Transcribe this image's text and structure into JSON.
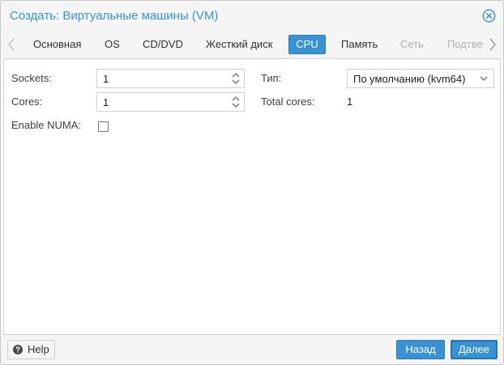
{
  "window": {
    "title": "Создать: Виртуальные машины (VM)"
  },
  "tabs": [
    {
      "label": "Основная",
      "state": "normal"
    },
    {
      "label": "OS",
      "state": "normal"
    },
    {
      "label": "CD/DVD",
      "state": "normal"
    },
    {
      "label": "Жесткий диск",
      "state": "normal"
    },
    {
      "label": "CPU",
      "state": "active"
    },
    {
      "label": "Память",
      "state": "normal"
    },
    {
      "label": "Сеть",
      "state": "disabled"
    },
    {
      "label": "Подтве",
      "state": "disabled"
    }
  ],
  "form": {
    "sockets": {
      "label": "Sockets:",
      "value": "1"
    },
    "cores": {
      "label": "Cores:",
      "value": "1"
    },
    "numa": {
      "label": "Enable NUMA:",
      "checked": false
    },
    "type": {
      "label": "Тип:",
      "value": "По умолчанию (kvm64)"
    },
    "total_cores": {
      "label": "Total cores:",
      "value": "1"
    }
  },
  "footer": {
    "help_label": "Help",
    "back_label": "Назад",
    "next_label": "Далее"
  },
  "colors": {
    "accent": "#3892d4",
    "title_text": "#3892d4",
    "disabled_tab": "#b0b0b0"
  },
  "icons": {
    "close": "close-circle-icon",
    "help": "question-circle-icon",
    "scroll_left": "chevron-left-icon",
    "scroll_right": "chevron-right-icon",
    "spinner": "spinner-arrows-icon",
    "dropdown": "chevron-down-icon"
  }
}
